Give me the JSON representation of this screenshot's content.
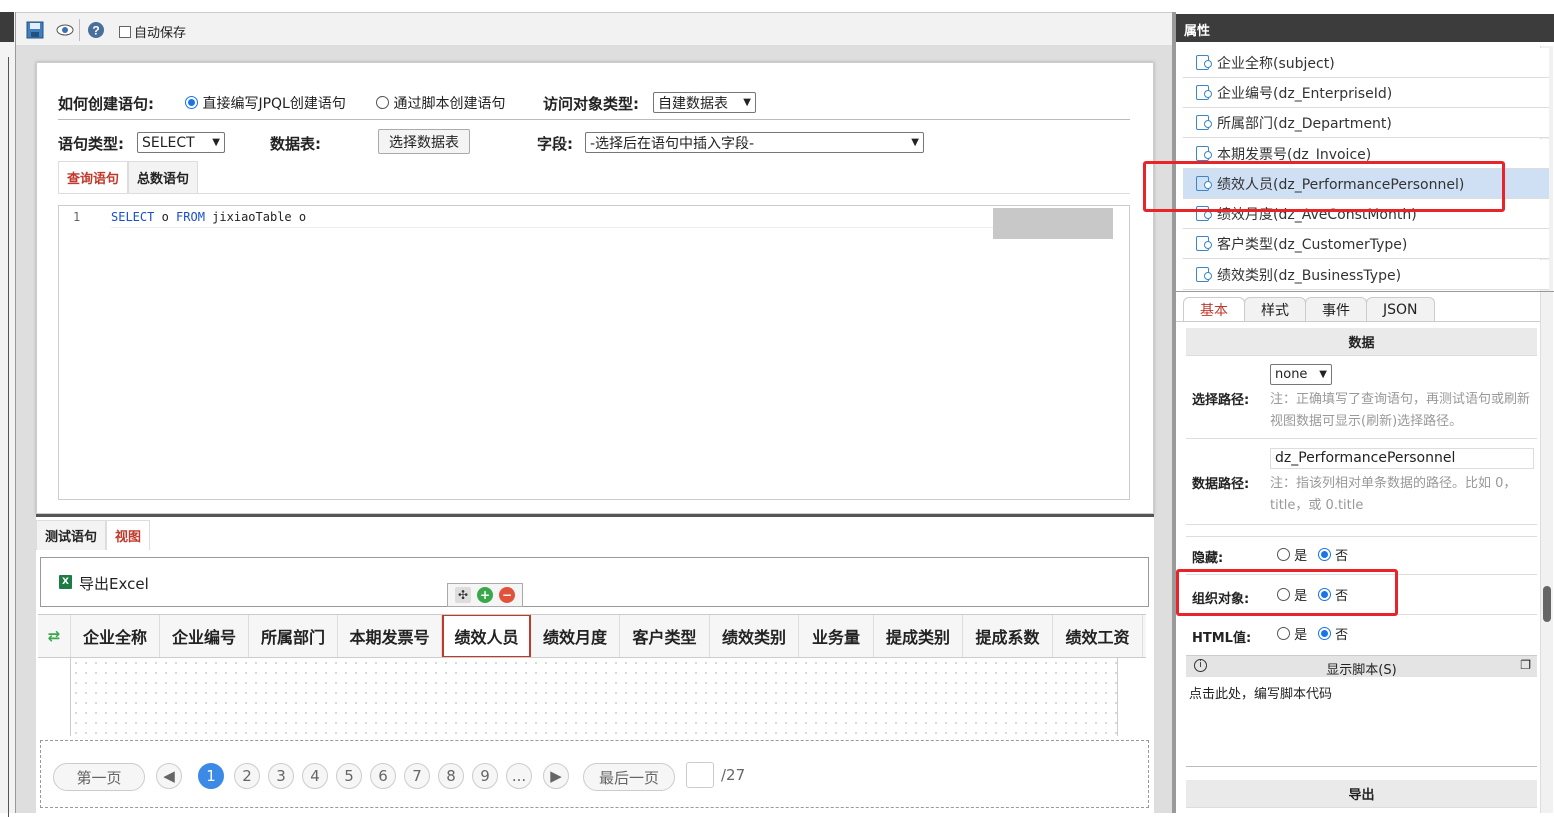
{
  "toolbar": {
    "autosave_label": "自动保存",
    "icons": [
      "save-icon",
      "preview-icon",
      "help-icon"
    ]
  },
  "sql": {
    "how_create_label": "如何创建语句:",
    "option_direct": "直接编写JPQL创建语句",
    "option_script": "通过脚本创建语句",
    "access_type_label": "访问对象类型:",
    "access_type_value": "自建数据表",
    "stmt_type_label": "语句类型:",
    "stmt_type_value": "SELECT",
    "table_label": "数据表:",
    "table_button": "选择数据表",
    "field_label": "字段:",
    "field_value": "-选择后在语句中插入字段-",
    "tabs": [
      "查询语句",
      "总数语句"
    ],
    "editor": {
      "line": "1",
      "kw1": "SELECT",
      "t1": " o ",
      "kw2": "FROM",
      "t2": " jixiaoTable o"
    }
  },
  "view": {
    "tabs": [
      "测试语句",
      "视图"
    ],
    "export_label": "导出Excel",
    "columns": [
      "企业全称",
      "企业编号",
      "所属部门",
      "本期发票号",
      "绩效人员",
      "绩效月度",
      "客户类型",
      "绩效类别",
      "业务量",
      "提成类别",
      "提成系数",
      "绩效工资"
    ],
    "selected_column": "绩效人员",
    "pager": {
      "first": "第一页",
      "pages": [
        "1",
        "2",
        "3",
        "4",
        "5",
        "6",
        "7",
        "8",
        "9",
        "..."
      ],
      "current": "1",
      "last": "最后一页",
      "total": "/27"
    }
  },
  "props": {
    "title": "属性",
    "fields": [
      "企业全称(subject)",
      "企业编号(dz_EnterpriseId)",
      "所属部门(dz_Department)",
      "本期发票号(dz_Invoice)",
      "绩效人员(dz_PerformancePersonnel)",
      "绩效月度(dz_AveConstMonth)",
      "客户类型(dz_CustomerType)",
      "绩效类别(dz_BusinessType)"
    ],
    "selected_field": "绩效人员(dz_PerformancePersonnel)",
    "tabs": [
      "基本",
      "样式",
      "事件",
      "JSON"
    ],
    "section_data": "数据",
    "select_path_label": "选择路径:",
    "select_path_value": "none",
    "select_path_note": "注：正确填写了查询语句，再测试语句或刷新视图数据可显示(刷新)选择路径。",
    "data_path_label": "数据路径:",
    "data_path_value": "dz_PerformancePersonnel",
    "data_path_note": "注：指该列相对单条数据的路径。比如 0，title，或 0.title",
    "hidden_label": "隐藏:",
    "org_label": "组织对象:",
    "html_label": "HTML值:",
    "yes": "是",
    "no": "否",
    "script_label": "显示脚本(S)",
    "script_hint": "点击此处，编写脚本代码",
    "section_export": "导出"
  },
  "colors": {
    "accent_red": "#e8232a",
    "active_tab": "#c0392b",
    "page_current": "#3b8ae6",
    "highlight_row": "#cfe0f5"
  }
}
